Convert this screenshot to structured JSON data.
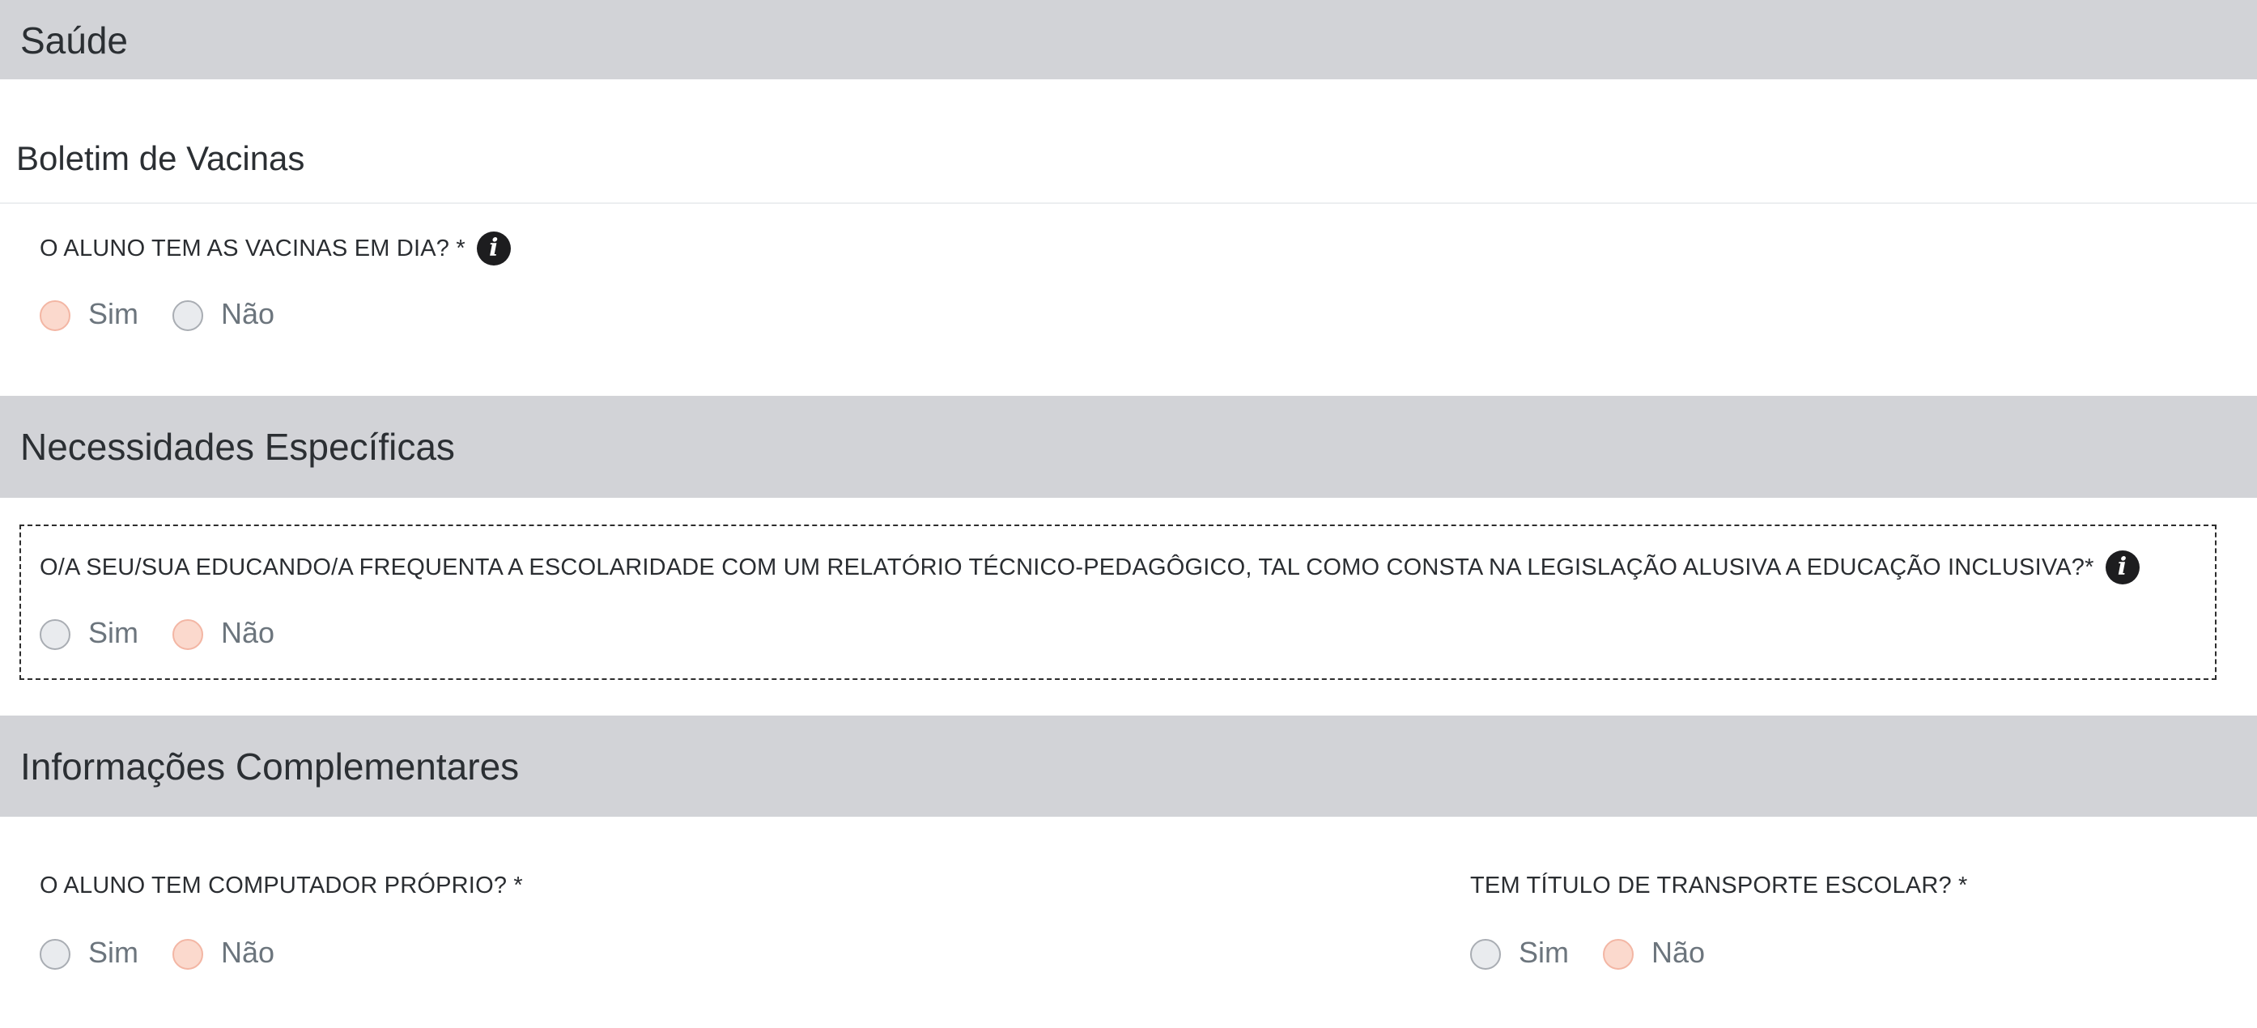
{
  "sections": {
    "saude": {
      "title": "Saúde"
    },
    "necessidades": {
      "title": "Necessidades Específicas"
    },
    "complementares": {
      "title": "Informações Complementares"
    }
  },
  "boletim": {
    "subheading": "Boletim de Vacinas",
    "question": "O ALUNO TEM AS VACINAS EM DIA? *",
    "selected": "Sim"
  },
  "relatorio": {
    "question": "O/A SEU/SUA EDUCANDO/A FREQUENTA A ESCOLARIDADE COM UM RELATÓRIO TÉCNICO-PEDAGÔGICO, TAL COMO CONSTA NA LEGISLAÇÃO ALUSIVA A EDUCAÇÃO INCLUSIVA?*",
    "selected": "Não"
  },
  "computador": {
    "question": "O ALUNO TEM COMPUTADOR PRÓPRIO? *",
    "selected": "Não"
  },
  "transporte": {
    "question": "TEM TÍTULO DE TRANSPORTE ESCOLAR? *",
    "selected": "Não"
  },
  "options": {
    "yes": "Sim",
    "no": "Não"
  },
  "icons": {
    "info": "info-circle-icon",
    "info_glyph": "i"
  },
  "colors": {
    "section_bg": "#d2d3d7",
    "radio_checked_bg": "#fbd9cd",
    "radio_unchecked_bg": "#e9ebee"
  }
}
